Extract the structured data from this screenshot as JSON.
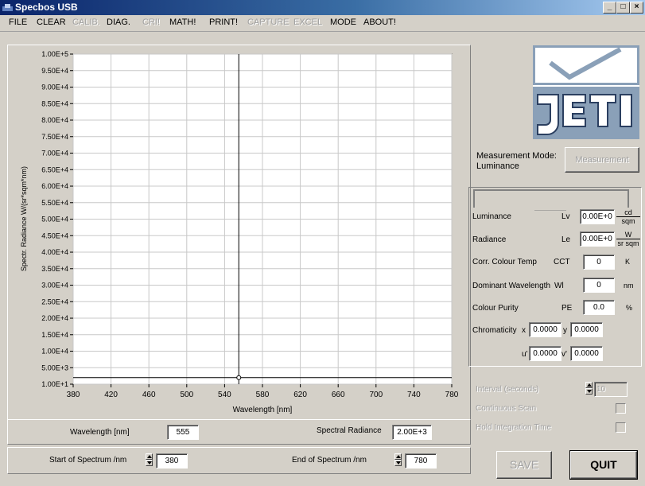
{
  "window": {
    "title": "Specbos USB",
    "minimize": "_",
    "maximize": "□",
    "close": "×"
  },
  "menu": [
    {
      "label": "FILE",
      "enabled": true
    },
    {
      "label": "CLEAR",
      "enabled": true
    },
    {
      "label": "CALIB.",
      "enabled": false
    },
    {
      "label": "DIAG.",
      "enabled": true
    },
    {
      "label": "CRI!",
      "enabled": false
    },
    {
      "label": "MATH!",
      "enabled": true
    },
    {
      "label": "PRINT!",
      "enabled": true
    },
    {
      "label": "CAPTURE",
      "enabled": false
    },
    {
      "label": "EXCEL",
      "enabled": false
    },
    {
      "label": "MODE",
      "enabled": true
    },
    {
      "label": "ABOUT!",
      "enabled": true
    }
  ],
  "chart_data": {
    "type": "line",
    "xlabel": "Wavelength [nm]",
    "ylabel": "Spectr. Radiance W/(sr*sqm*nm)",
    "xlim": [
      380,
      780
    ],
    "ylim": [
      10,
      100000
    ],
    "x_ticks": [
      380,
      420,
      460,
      500,
      540,
      580,
      620,
      660,
      700,
      740,
      780
    ],
    "y_ticks": [
      10,
      5000,
      10000,
      15000,
      20000,
      25000,
      30000,
      35000,
      40000,
      45000,
      50000,
      55000,
      60000,
      65000,
      70000,
      75000,
      80000,
      85000,
      90000,
      95000,
      100000
    ],
    "y_tick_labels": [
      "1.00E+1",
      "5.00E+3",
      "1.00E+4",
      "1.50E+4",
      "2.00E+4",
      "2.50E+4",
      "3.00E+4",
      "3.50E+4",
      "4.00E+4",
      "4.50E+4",
      "5.00E+4",
      "5.50E+4",
      "6.00E+4",
      "6.50E+4",
      "7.00E+4",
      "7.50E+4",
      "8.00E+4",
      "8.50E+4",
      "9.00E+4",
      "9.50E+4",
      "1.00E+5"
    ],
    "grid": true,
    "series": [
      {
        "x": [
          380,
          780
        ],
        "y": [
          2000,
          2000
        ]
      }
    ],
    "cursor": {
      "x": 555,
      "y": 2000
    }
  },
  "measurement": {
    "mode_label": "Measurement Mode:",
    "mode_value": "Luminance",
    "button": "Measurement"
  },
  "results": [
    {
      "label": "Luminance",
      "sym": "Lv",
      "value": "0.00E+0",
      "unit_num": "cd",
      "unit_den": "sqm"
    },
    {
      "label": "Radiance",
      "sym": "Le",
      "value": "0.00E+0",
      "unit_num": "W",
      "unit_den": "sr sqm"
    },
    {
      "label": "Corr. Colour Temp",
      "sym": "CCT",
      "value": "0",
      "unit": "K"
    },
    {
      "label": "Dominant Wavelength",
      "sym": "Wl",
      "value": "0",
      "unit": "nm"
    },
    {
      "label": "Colour Purity",
      "sym": "PE",
      "value": "0.0",
      "unit": "%"
    }
  ],
  "chromaticity": {
    "label": "Chromaticity",
    "x_label": "x",
    "x_value": "0.0000",
    "y_label": "y",
    "y_value": "0.0000",
    "u_label": "u'",
    "u_value": "0.0000",
    "v_label": "v'",
    "v_value": "0.0000"
  },
  "options": {
    "interval_label": "Interval (seconds)",
    "interval_value": "10",
    "continuous_scan": "Continuous Scan",
    "hold_integration": "Hold Integration Time"
  },
  "cursor_panel": {
    "wavelength_label": "Wavelength [nm]",
    "wavelength_value": "555",
    "radiance_label": "Spectral Radiance",
    "radiance_value": "2.00E+3"
  },
  "range_panel": {
    "start_label": "Start of Spectrum /nm",
    "start_value": "380",
    "end_label": "End of Spectrum /nm",
    "end_value": "780"
  },
  "buttons": {
    "save": "SAVE",
    "quit": "QUIT"
  }
}
